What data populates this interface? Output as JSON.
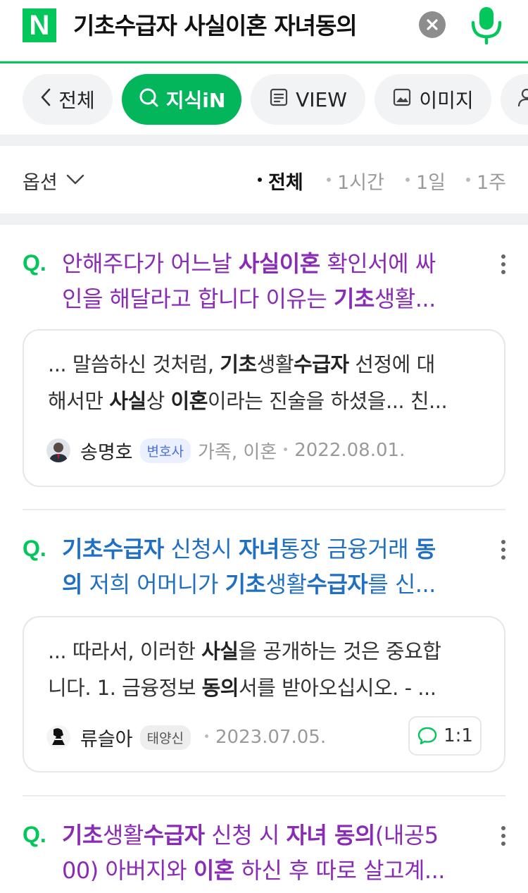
{
  "search": {
    "logo_letter": "N",
    "query": "기초수급자 사실이혼 자녀동의"
  },
  "tabs": [
    {
      "label": "전체",
      "icon": "chevron-left-icon"
    },
    {
      "label": "지식iN",
      "icon": "search-q-icon",
      "active": true
    },
    {
      "label": "VIEW",
      "icon": "document-icon"
    },
    {
      "label": "이미지",
      "icon": "image-icon"
    }
  ],
  "options": {
    "label": "옵션",
    "filters": [
      {
        "label": "전체",
        "active": true
      },
      {
        "label": "1시간"
      },
      {
        "label": "1일"
      },
      {
        "label": "1주"
      }
    ]
  },
  "results": [
    {
      "q_mark": "Q.",
      "title_lines": [
        [
          {
            "t": "안해주다가 어느날 ",
            "b": false
          },
          {
            "t": "사실이혼",
            "b": true
          },
          {
            "t": " 확인서에 싸",
            "b": false
          }
        ],
        [
          {
            "t": "인을 해달라고 합니다 이유는 ",
            "b": false
          },
          {
            "t": "기초",
            "b": true
          },
          {
            "t": "생활...",
            "b": false
          }
        ]
      ],
      "snippet_lines": [
        [
          {
            "t": "... 말씀하신 것처럼, ",
            "b": false
          },
          {
            "t": "기초",
            "b": true
          },
          {
            "t": "생활",
            "b": false
          },
          {
            "t": "수급자",
            "b": true
          },
          {
            "t": " 선정에 대",
            "b": false
          }
        ],
        [
          {
            "t": "해서만 ",
            "b": false
          },
          {
            "t": "사실",
            "b": true
          },
          {
            "t": "상 ",
            "b": false
          },
          {
            "t": "이혼",
            "b": true
          },
          {
            "t": "이라는 진술을 하셨을... 친...",
            "b": false
          }
        ]
      ],
      "author": "송명호",
      "badge": "변호사",
      "category": "가족, 이혼",
      "date": "2022.08.01."
    },
    {
      "q_mark": "Q.",
      "title_lines": [
        [
          {
            "t": "기초수급자",
            "b": true
          },
          {
            "t": " 신청시 ",
            "b": false
          },
          {
            "t": "자녀",
            "b": true
          },
          {
            "t": "통장 금융거래 ",
            "b": false
          },
          {
            "t": "동",
            "b": true
          }
        ],
        [
          {
            "t": "의",
            "b": true
          },
          {
            "t": " 저희 어머니가 ",
            "b": false
          },
          {
            "t": "기초",
            "b": true
          },
          {
            "t": "생활",
            "b": false
          },
          {
            "t": "수급자",
            "b": true
          },
          {
            "t": "를 신...",
            "b": false
          }
        ]
      ],
      "snippet_lines": [
        [
          {
            "t": "... 따라서, 이러한 ",
            "b": false
          },
          {
            "t": "사실",
            "b": true
          },
          {
            "t": "을 공개하는 것은 중요합",
            "b": false
          }
        ],
        [
          {
            "t": "니다. 1. 금융정보 ",
            "b": false
          },
          {
            "t": "동의",
            "b": true
          },
          {
            "t": "서를 받아오십시오. - ...",
            "b": false
          }
        ]
      ],
      "author": "류슬아",
      "badge": "태양신",
      "date": "2023.07.05.",
      "answers": "1:1"
    },
    {
      "q_mark": "Q.",
      "title_lines": [
        [
          {
            "t": "기초",
            "b": true
          },
          {
            "t": "생활",
            "b": false
          },
          {
            "t": "수급자",
            "b": true
          },
          {
            "t": " 신청 시 ",
            "b": false
          },
          {
            "t": "자녀 동의",
            "b": true
          },
          {
            "t": "(내공5",
            "b": false
          }
        ],
        [
          {
            "t": "00) 아버지와 ",
            "b": false
          },
          {
            "t": "이혼",
            "b": true
          },
          {
            "t": " 하신 후 따로 살고계...",
            "b": false
          }
        ]
      ]
    }
  ],
  "colors": {
    "brand_green": "#03c75a",
    "visited_title": "#8a2bb6",
    "link_title": "#1f6fc2"
  }
}
